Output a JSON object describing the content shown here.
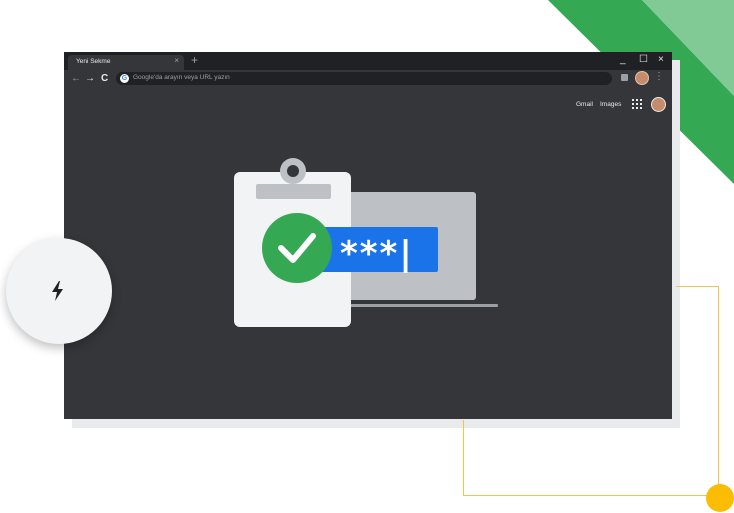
{
  "tab": {
    "title": "Yeni Sekme",
    "close_glyph": "×"
  },
  "newtab_glyph": "+",
  "window": {
    "minimize": "_",
    "maximize": "☐",
    "close": "×"
  },
  "nav": {
    "back": "←",
    "forward": "→",
    "reload": "C"
  },
  "omnibox": {
    "placeholder": "Google'da arayın veya URL yazın",
    "logo": "G"
  },
  "menu_glyph": "⋮",
  "ntp": {
    "gmail": "Gmail",
    "images": "Images"
  },
  "illustration": {
    "password_mask": "***|"
  },
  "icons": [
    "apps-grid-icon",
    "lightning-bolt-icon",
    "checkmark-icon",
    "extension-icon",
    "profile-avatar"
  ],
  "colors": {
    "green": "#34a853",
    "light_green": "#81c995",
    "blue": "#1a73e8",
    "yellow": "#fbbc04",
    "frame": "#202124",
    "surface": "#35363a"
  }
}
